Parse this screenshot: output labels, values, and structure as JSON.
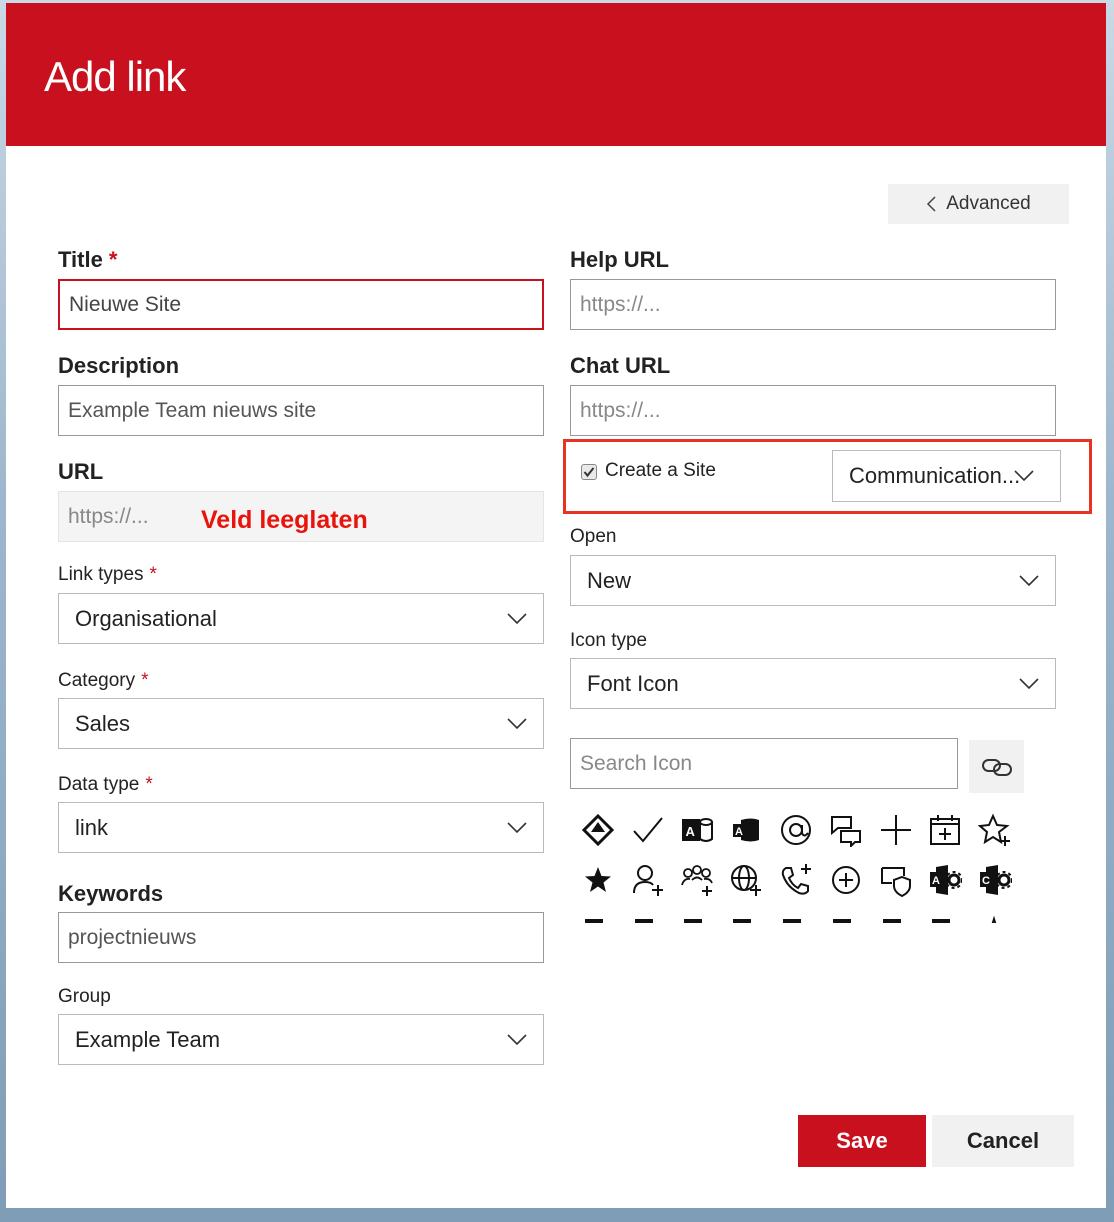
{
  "dialog": {
    "title": "Add link",
    "advanced_label": "Advanced",
    "save_label": "Save",
    "cancel_label": "Cancel"
  },
  "left": {
    "title": {
      "label": "Title",
      "required": "*",
      "value": "Nieuwe Site"
    },
    "description": {
      "label": "Description",
      "value": "Example Team nieuws site"
    },
    "url": {
      "label": "URL",
      "placeholder": "https://...",
      "annotation": "Veld leeglaten"
    },
    "link_types": {
      "label": "Link types",
      "required": "*",
      "value": "Organisational"
    },
    "category": {
      "label": "Category",
      "required": "*",
      "value": "Sales"
    },
    "data_type": {
      "label": "Data type",
      "required": "*",
      "value": "link"
    },
    "keywords": {
      "label": "Keywords",
      "value": "projectnieuws"
    },
    "group": {
      "label": "Group",
      "value": "Example Team"
    }
  },
  "right": {
    "help_url": {
      "label": "Help URL",
      "placeholder": "https://..."
    },
    "chat_url": {
      "label": "Chat URL",
      "placeholder": "https://..."
    },
    "create_site": {
      "label": "Create a Site",
      "checked": true,
      "type_value": "Communication..."
    },
    "open": {
      "label": "Open",
      "value": "New"
    },
    "icon_type": {
      "label": "Icon type",
      "value": "Font Icon"
    },
    "search_icon": {
      "placeholder": "Search Icon"
    }
  },
  "icons": [
    "azure-devops-icon",
    "checkmark-icon",
    "access-database-icon",
    "access-logo-icon",
    "at-mention-icon",
    "chat-bubbles-icon",
    "plus-icon",
    "calendar-add-icon",
    "add-favorite-icon",
    "star-filled-icon",
    "add-friend-icon",
    "add-group-icon",
    "add-online-meeting-icon",
    "add-phone-icon",
    "circle-plus-icon",
    "admin-shield-icon",
    "access-admin-icon",
    "admin-settings-icon"
  ],
  "colors": {
    "brand": "#c8101e",
    "annotation": "#e8140c"
  }
}
